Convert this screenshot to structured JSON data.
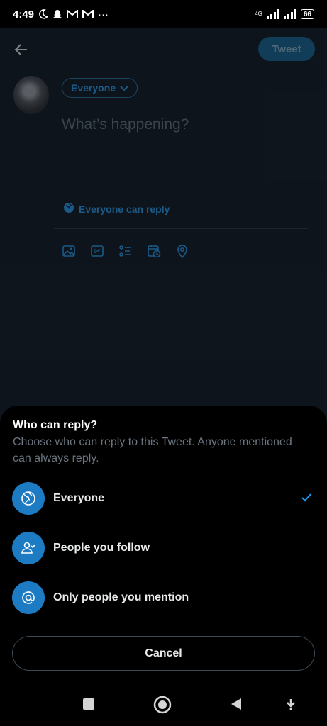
{
  "status_bar": {
    "time": "4:49",
    "network": "4G",
    "battery": "66",
    "more": "···"
  },
  "compose": {
    "tweet_button": "Tweet",
    "audience": "Everyone",
    "placeholder": "What’s happening?",
    "reply_setting": "Everyone can reply",
    "toolbar_icons": [
      "image-icon",
      "gif-icon",
      "poll-icon",
      "schedule-icon",
      "location-icon"
    ]
  },
  "sheet": {
    "title": "Who can reply?",
    "description": "Choose who can reply to this Tweet. Anyone mentioned can always reply.",
    "options": [
      {
        "label": "Everyone",
        "icon": "globe-icon",
        "selected": true
      },
      {
        "label": "People you follow",
        "icon": "people-follow-icon",
        "selected": false
      },
      {
        "label": "Only people you mention",
        "icon": "at-icon",
        "selected": false
      }
    ],
    "cancel": "Cancel"
  },
  "colors": {
    "accent": "#1d9bf0",
    "background": "#15202b",
    "sheet": "#000000"
  }
}
